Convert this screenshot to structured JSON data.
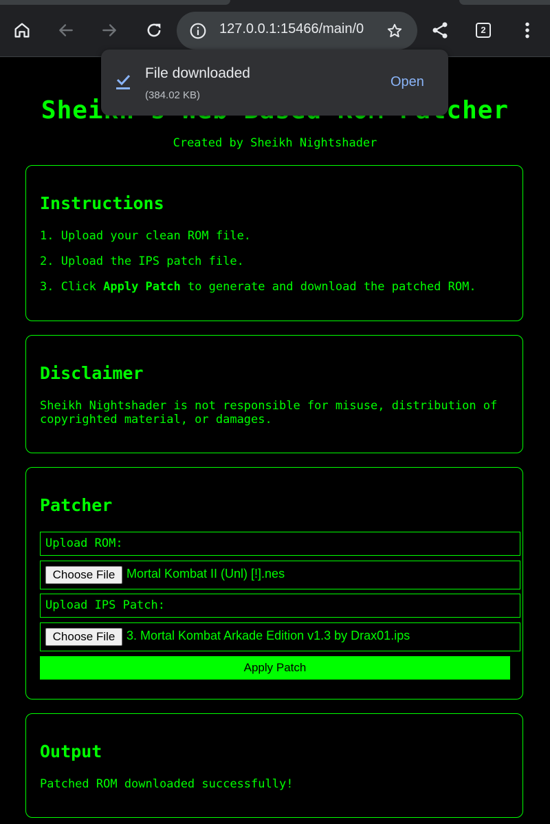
{
  "browser": {
    "url": "127.0.0.1:15466/main/0",
    "tab_count": "2"
  },
  "download": {
    "title": "File downloaded",
    "size": "(384.02 KB)",
    "action": "Open"
  },
  "page": {
    "title": "Sheikh's Web Based ROM Patcher",
    "subtitle": "Created by Sheikh Nightshader"
  },
  "instructions": {
    "heading": "Instructions",
    "step1": "1. Upload your clean ROM file.",
    "step2": "2. Upload the IPS patch file.",
    "step3_prefix": "3. Click ",
    "step3_bold": "Apply Patch",
    "step3_suffix": " to generate and download the patched ROM."
  },
  "disclaimer": {
    "heading": "Disclaimer",
    "text": "Sheikh Nightshader is not responsible for misuse, distribution of copyrighted material, or damages."
  },
  "patcher": {
    "heading": "Patcher",
    "rom_label": "Upload ROM:",
    "rom_button": "Choose File",
    "rom_file": "Mortal Kombat II (Unl) [!].nes",
    "ips_label": "Upload IPS Patch:",
    "ips_button": "Choose File",
    "ips_file": "3. Mortal Kombat Arkade Edition v1.3 by Drax01.ips",
    "apply_label": "Apply Patch"
  },
  "output": {
    "heading": "Output",
    "text": "Patched ROM downloaded successfully!"
  },
  "colors": {
    "accent": "#00ff00",
    "background": "#000000",
    "chrome": "#202124",
    "link": "#8ab4f8"
  }
}
